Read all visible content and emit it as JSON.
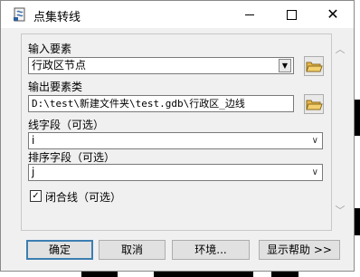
{
  "window": {
    "title": "点集转线"
  },
  "form": {
    "input_features": {
      "label": "输入要素",
      "value": "行政区节点"
    },
    "output_features": {
      "label": "输出要素类",
      "value": "D:\\test\\新建文件夹\\test.gdb\\行政区_边线"
    },
    "line_field": {
      "label": "线字段（可选）",
      "value": "i"
    },
    "sort_field": {
      "label": "排序字段（可选）",
      "value": "j"
    },
    "close_line": {
      "label": "闭合线（可选）",
      "checked": true
    }
  },
  "buttons": {
    "ok": "确定",
    "cancel": "取消",
    "environments": "环境...",
    "show_help": "显示帮助 >>"
  },
  "icons": {
    "app": "python-script-icon",
    "minimize": "minimize-icon",
    "maximize": "maximize-icon",
    "close": "close-icon",
    "folder": "open-folder-icon"
  },
  "colors": {
    "default_button_border": "#3c7fb1",
    "folder_yellow": "#e8b84a"
  }
}
